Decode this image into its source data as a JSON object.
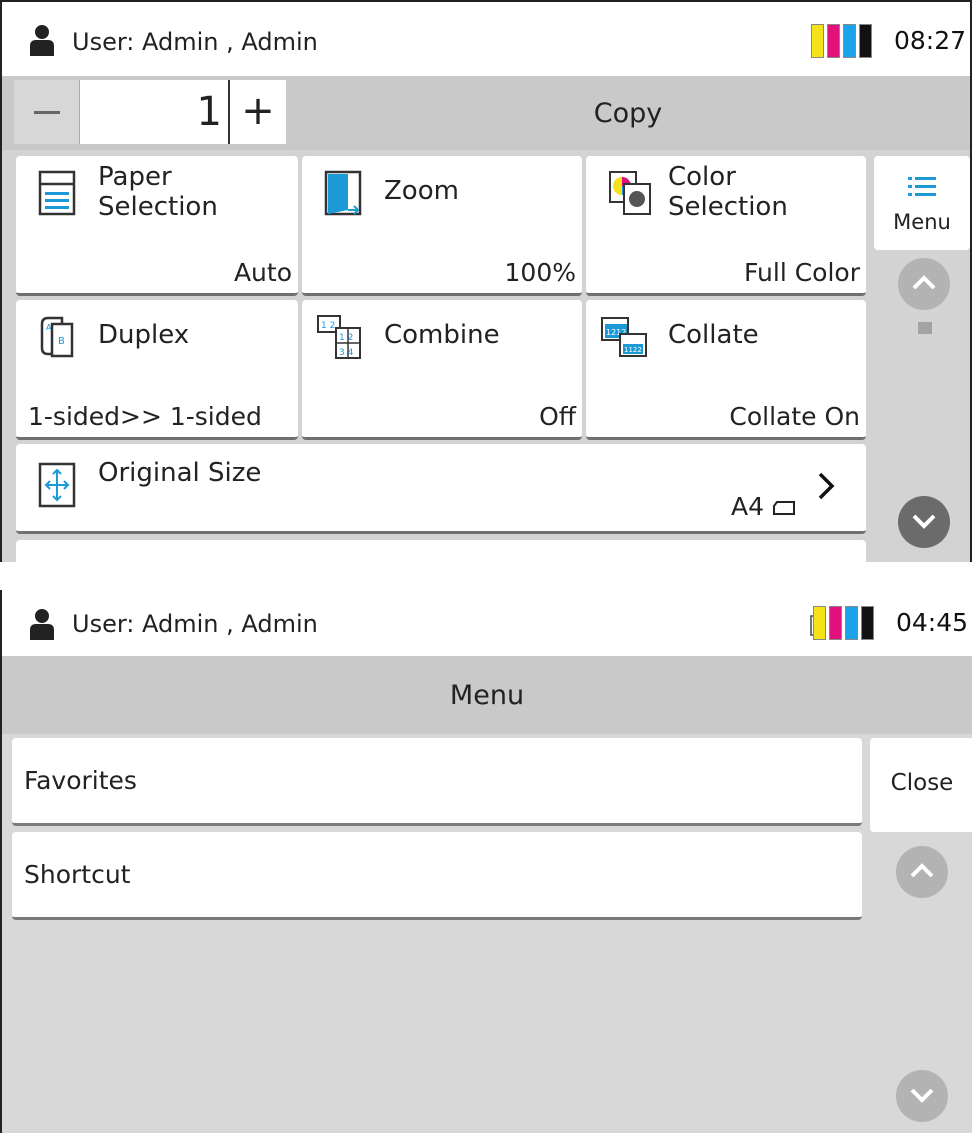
{
  "copy_screen": {
    "status": {
      "user_text": "User: Admin , Admin",
      "time": "08:27"
    },
    "toner_colors": [
      "#f5e21a",
      "#e0117a",
      "#1aa3e8",
      "#111111"
    ],
    "copies": {
      "value": "1",
      "plus_label": "+"
    },
    "title": "Copy",
    "tiles": [
      {
        "name": "Paper\nSelection",
        "value": "Auto",
        "icon": "paper-selection-icon"
      },
      {
        "name": "Zoom",
        "value": "100%",
        "icon": "zoom-icon"
      },
      {
        "name": "Color\nSelection",
        "value": "Full Color",
        "icon": "color-selection-icon"
      },
      {
        "name": "Duplex",
        "value": "1-sided>> 1-sided",
        "icon": "duplex-icon"
      },
      {
        "name": "Combine",
        "value": "Off",
        "icon": "combine-icon"
      },
      {
        "name": "Collate",
        "value": "Collate On",
        "icon": "collate-icon"
      },
      {
        "name": "Original Size",
        "value": "A4",
        "icon": "original-size-icon"
      }
    ],
    "menu_label": "Menu"
  },
  "menu_screen": {
    "status": {
      "user_text": "User: Admin , Admin",
      "time": "04:45"
    },
    "toner_colors": [
      "#f5e21a",
      "#e0117a",
      "#1aa3e8",
      "#111111"
    ],
    "title": "Menu",
    "items": [
      "Favorites",
      "Shortcut"
    ],
    "close_label": "Close"
  }
}
